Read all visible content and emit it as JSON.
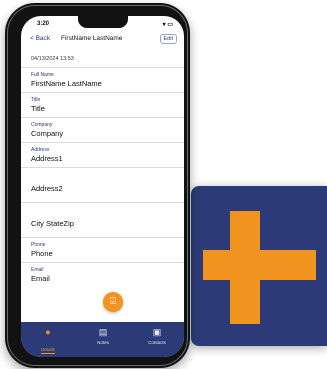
{
  "colors": {
    "brand_navy": "#2c3a78",
    "accent_orange": "#f0941f",
    "screen_bg": "#ffffff"
  },
  "logo": {
    "icon": "plus-icon"
  },
  "status_bar": {
    "time": "3:20",
    "indicators": "▾ ▭"
  },
  "nav": {
    "back_label": "< Back",
    "title": "FirstName LastName",
    "edit_label": "Edit"
  },
  "detail": {
    "timestamp": "04/13/2024 13:53",
    "fields": [
      {
        "label": "Full Name",
        "value": "FirstName LastName"
      },
      {
        "label": "Title",
        "value": "Title"
      },
      {
        "label": "Company",
        "value": "Company"
      },
      {
        "label": "Address",
        "value": "Address1"
      },
      {
        "label": "",
        "value": "Address2"
      },
      {
        "label": "",
        "value": "City StateZip"
      },
      {
        "label": "Phone",
        "value": "Phone"
      },
      {
        "label": "Email",
        "value": "Email"
      }
    ]
  },
  "fab": {
    "icon": "scan-icon",
    "glyph": "⌹"
  },
  "tabs": [
    {
      "label": "Details",
      "icon": "details-icon",
      "glyph": "●"
    },
    {
      "label": "Notes",
      "icon": "notes-icon",
      "glyph": "▤"
    },
    {
      "label": "Contacts",
      "icon": "contacts-icon",
      "glyph": "▣"
    }
  ]
}
